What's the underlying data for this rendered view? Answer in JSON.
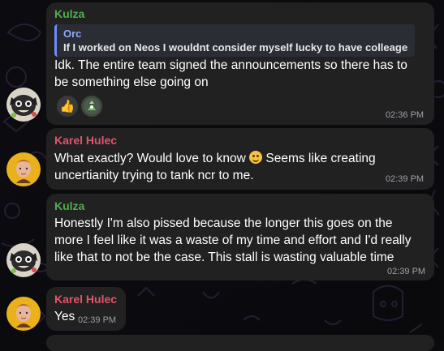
{
  "messages": [
    {
      "sender": "Kulza",
      "reply": {
        "name": "Orc",
        "text": "If I worked on Neos I wouldnt consider myself lucky to have colleages t..."
      },
      "lines": [
        "Idk. The entire team signed the announcements so there has to",
        "be something else going on"
      ],
      "reactions": [
        "thumbs-up-emoji",
        "plant-creature-emoji"
      ],
      "time": "02:36 PM"
    },
    {
      "sender": "Karel Hulec",
      "line1_before_emoji": "What exactly? Would love to know ",
      "line1_after_emoji": " Seems like creating",
      "line2": "uncertianity trying to tank ncr to me.",
      "time": "02:39 PM"
    },
    {
      "sender": "Kulza",
      "lines": [
        "Honestly I'm also pissed because the longer this goes on the",
        "more I feel like it was a waste of my time and effort and I'd really",
        "like that to not be the case. This stall is wasting valuable time"
      ],
      "time": "02:39 PM"
    },
    {
      "sender": "Karel Hulec",
      "text": "Yes",
      "time": "02:39 PM"
    }
  ],
  "colors": {
    "bubble": "#212121",
    "kulza_name": "#4fae4e",
    "karel_name": "#e0566b",
    "reply_bar": "#6a8cff",
    "background": "#0b0b0e"
  }
}
